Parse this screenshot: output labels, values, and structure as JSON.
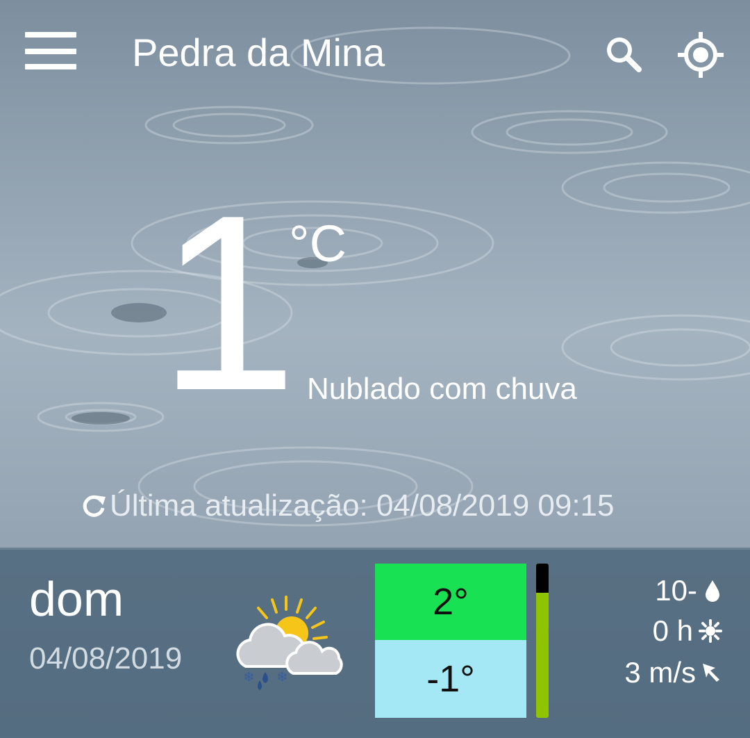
{
  "header": {
    "title": "Pedra da Mina",
    "icons": {
      "menu": "hamburger-menu-icon",
      "search": "search-icon",
      "location": "my-location-icon"
    }
  },
  "current": {
    "temperature": "1",
    "unit": "°C",
    "condition": "Nublado com chuva",
    "last_update": "Última atualização: 04/08/2019 09:15"
  },
  "forecast": {
    "day": "dom",
    "date": "04/08/2019",
    "weather_icon": "partly-cloudy-snow-rain-icon",
    "max": "2°",
    "min": "-1°",
    "bar_fill_fraction": 0.81,
    "rain": "10-",
    "sun_hours": "0 h",
    "wind": "3 m/s",
    "colors": {
      "max_bg": "#18e254",
      "min_bg": "#a4e8f6",
      "bar": "#8fc400"
    }
  }
}
